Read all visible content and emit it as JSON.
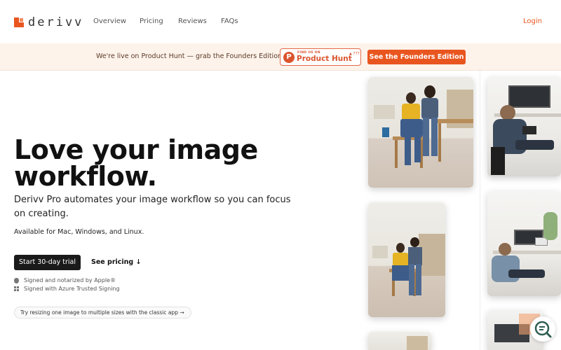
{
  "nav": {
    "logo_text": "derivv",
    "links": [
      "Overview",
      "Pricing",
      "Reviews",
      "FAQs"
    ],
    "login": "Login"
  },
  "banner": {
    "text": "We're live on Product Hunt — grab the Founders Edition ▯",
    "ph_small": "FIND US ON",
    "ph_big": "Product Hunt",
    "ph_count": "▲ 777",
    "cta": "See the Founders Edition"
  },
  "hero": {
    "title": "Love your image workflow.",
    "subtitle": "Derivv Pro automates your image workflow so you can focus on creating.",
    "platforms": "Available for Mac, Windows, and Linux.",
    "trial_button": "Start 30-day trial",
    "pricing_link": "See pricing ↓",
    "signed_apple": "Signed and notarized by Apple®",
    "signed_azure": "Signed with Azure Trusted Signing",
    "resize_pill": "Try resizing one image to multiple sizes with the classic app  →"
  },
  "colors": {
    "brand": "#e9551f",
    "banner_bg": "#fdf3ea",
    "product_hunt": "#da552f",
    "dark": "#1a1a1a"
  },
  "icons": {
    "logo": "derivv-logo-icon",
    "apple": "apple-icon",
    "windows": "windows-icon",
    "fab": "search-chat-icon"
  }
}
